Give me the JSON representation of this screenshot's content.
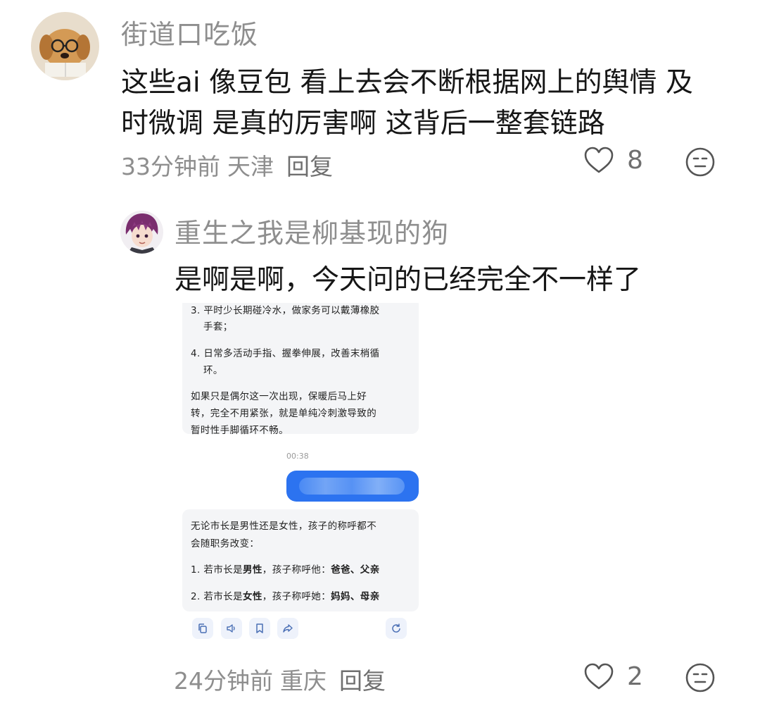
{
  "comments": [
    {
      "username": "街道口吃饭",
      "text_lines": [
        "这些ai 像豆包 看上去会不断根据网上的舆情 及",
        "时微调 是真的厉害啊 这背后一整套链路"
      ],
      "time": "33分钟前",
      "location": "天津",
      "reply_label": "回复",
      "likes": "8",
      "avatar_icon": "dog-with-glasses-avatar"
    },
    {
      "username": "重生之我是柳基现的狗",
      "text": "是啊是啊，今天问的已经完全不一样了",
      "time": "24分钟前",
      "location": "重庆",
      "reply_label": "回复",
      "likes": "2",
      "avatar_icon": "anime-character-avatar"
    }
  ],
  "screenshot": {
    "ai_reply_1": [
      "3. 平时少长期碰冷水，做家务可以戴薄橡胶",
      "手套；",
      "4. 日常多活动手指、握拳伸展，改善末梢循",
      "环。",
      "如果只是偶尔这一次出现，保暖后马上好",
      "转，完全不用紧张，就是单纯冷刺激导致的",
      "暂时性手脚循环不畅。"
    ],
    "timestamp": "00:38",
    "ai_reply_2": {
      "intro_1": "无论市长是男性还是女性，孩子的称呼都不",
      "intro_2": "会随职务改变：",
      "item1_prefix": "1. 若市长是",
      "item1_bold": "男性",
      "item1_mid": "，孩子称呼他：",
      "item1_answer": "爸爸、父亲",
      "item2_prefix": "2. 若市长是",
      "item2_bold": "女性",
      "item2_mid": "，孩子称呼她：",
      "item2_answer": "妈妈、母亲"
    },
    "toolbar_icons": [
      "copy-icon",
      "speaker-icon",
      "bookmark-icon",
      "share-icon",
      "refresh-icon"
    ]
  },
  "colors": {
    "meta": "#8e8e8e",
    "user_bubble": "#2c73f0",
    "ai_bubble": "#f4f5f7"
  }
}
